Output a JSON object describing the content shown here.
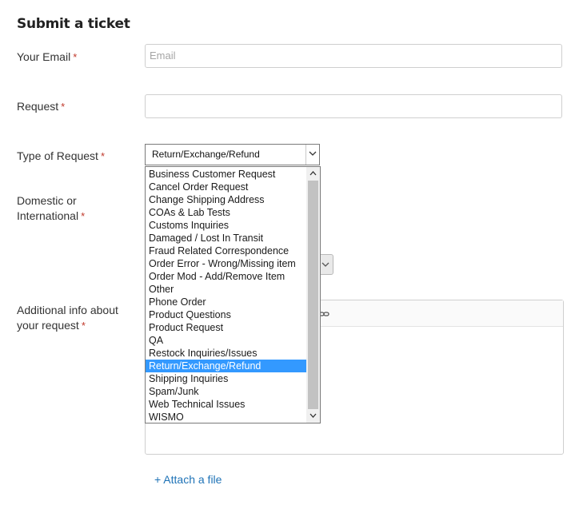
{
  "page_title": "Submit a ticket",
  "form": {
    "email": {
      "label": "Your Email",
      "placeholder": "Email",
      "required_mark": "*"
    },
    "request": {
      "label": "Request",
      "value": "",
      "required_mark": "*"
    },
    "type_of_request": {
      "label": "Type of Request",
      "required_mark": "*",
      "selected": "Return/Exchange/Refund",
      "options": [
        "Business Customer Request",
        "Cancel Order Request",
        "Change Shipping Address",
        "COAs & Lab Tests",
        "Customs Inquiries",
        "Damaged / Lost In Transit",
        "Fraud Related Correspondence",
        "Order Error - Wrong/Missing item",
        "Order Mod - Add/Remove Item",
        "Other",
        "Phone Order",
        "Product Questions",
        "Product Request",
        "QA",
        "Restock Inquiries/Issues",
        "Return/Exchange/Refund",
        "Shipping Inquiries",
        "Spam/Junk",
        "Web Technical Issues",
        "WISMO"
      ],
      "highlighted_index": 15
    },
    "domestic": {
      "label_line1": "Domestic or",
      "label_line2": "International",
      "required_mark": "*"
    },
    "additional_info": {
      "label_line1": "Additional info about",
      "label_line2": "your request",
      "required_mark": "*",
      "toolbar_icon": "link-icon"
    },
    "attach_label": "+ Attach a file"
  },
  "colors": {
    "required": "#c0392b",
    "link": "#1f73b7",
    "highlight": "#3399ff"
  }
}
